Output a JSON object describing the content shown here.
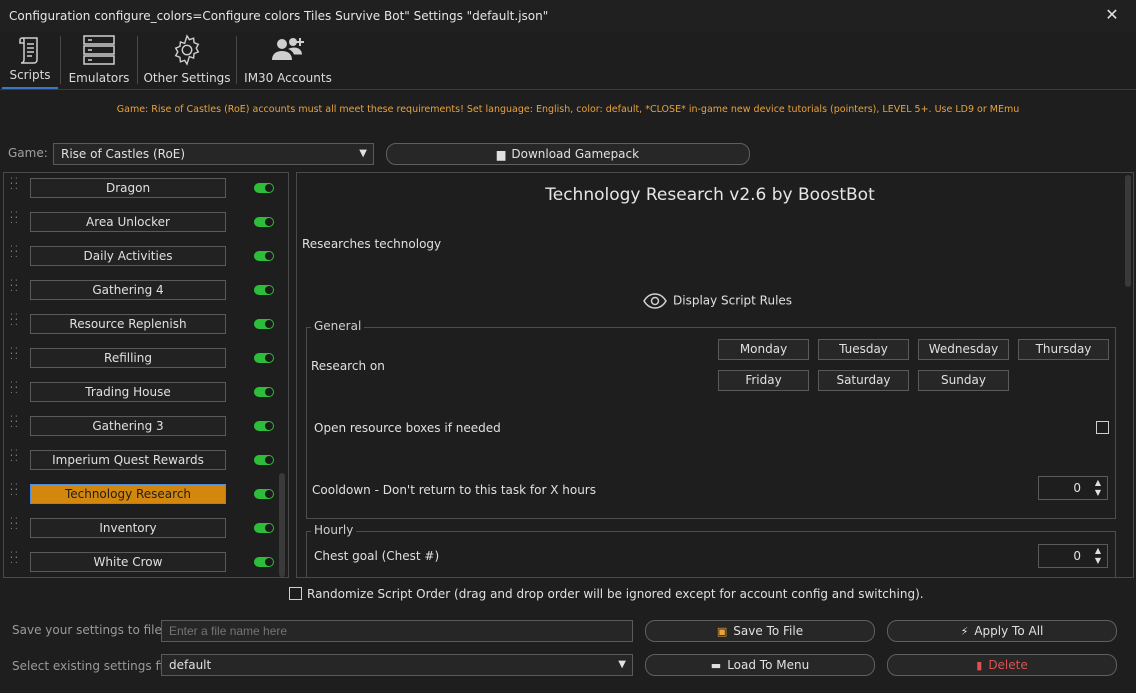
{
  "window": {
    "title": "Configuration configure_colors=Configure colors Tiles Survive Bot\" Settings \"default.json\"",
    "close_label": "✕"
  },
  "tabs": [
    {
      "label": "Scripts",
      "icon": "scroll-icon",
      "active": true
    },
    {
      "label": "Emulators",
      "icon": "server-icon"
    },
    {
      "label": "Other Settings",
      "icon": "gear-icon"
    },
    {
      "label": "IM30 Accounts",
      "icon": "users-icon"
    }
  ],
  "banner": "Game: Rise of Castles (RoE) accounts must all meet these requirements! Set language: English, color: default, *CLOSE* in-game new device tutorials (pointers), LEVEL 5+. Use LD9 or MEmu",
  "game": {
    "label": "Game:",
    "selected": "Rise of Castles (RoE)",
    "download_label": "Download Gamepack"
  },
  "scripts": [
    {
      "name": "Dragon",
      "enabled": true
    },
    {
      "name": "Area Unlocker",
      "enabled": true
    },
    {
      "name": "Daily Activities",
      "enabled": true
    },
    {
      "name": "Gathering 4",
      "enabled": true
    },
    {
      "name": "Resource Replenish",
      "enabled": true
    },
    {
      "name": "Refilling",
      "enabled": true
    },
    {
      "name": "Trading House",
      "enabled": true
    },
    {
      "name": "Gathering 3",
      "enabled": true
    },
    {
      "name": "Imperium Quest Rewards",
      "enabled": true
    },
    {
      "name": "Technology Research",
      "enabled": true,
      "selected": true
    },
    {
      "name": "Inventory",
      "enabled": true
    },
    {
      "name": "White Crow",
      "enabled": true
    }
  ],
  "detail": {
    "title": "Technology Research v2.6 by BoostBot",
    "description": "Researches technology",
    "rules_label": "Display Script Rules",
    "general": {
      "legend": "General",
      "research_on_label": "Research on",
      "days": [
        "Monday",
        "Tuesday",
        "Wednesday",
        "Thursday",
        "Friday",
        "Saturday",
        "Sunday"
      ],
      "open_boxes_label": "Open resource boxes if needed",
      "cooldown_label": "Cooldown - Don't return to this task for X hours",
      "cooldown_value": "0"
    },
    "hourly": {
      "legend": "Hourly",
      "chest_goal_label": "Chest goal (Chest #)",
      "chest_goal_value": "0"
    }
  },
  "randomize_label": "Randomize Script Order (drag and drop order will be ignored except for account config and switching).",
  "footer": {
    "save_label": "Save your settings to file",
    "file_placeholder": "Enter a file name here",
    "save_button": "Save To File",
    "apply_all_button": "Apply To All",
    "select_label": "Select existing settings file",
    "selected_file": "default",
    "load_button": "Load To Menu",
    "delete_button": "Delete"
  },
  "colors": {
    "accent": "#3a78c5",
    "selected_script": "#d4870d",
    "toggle_on": "#2ebd3b",
    "banner": "#e8a33c",
    "delete": "#e05050"
  }
}
